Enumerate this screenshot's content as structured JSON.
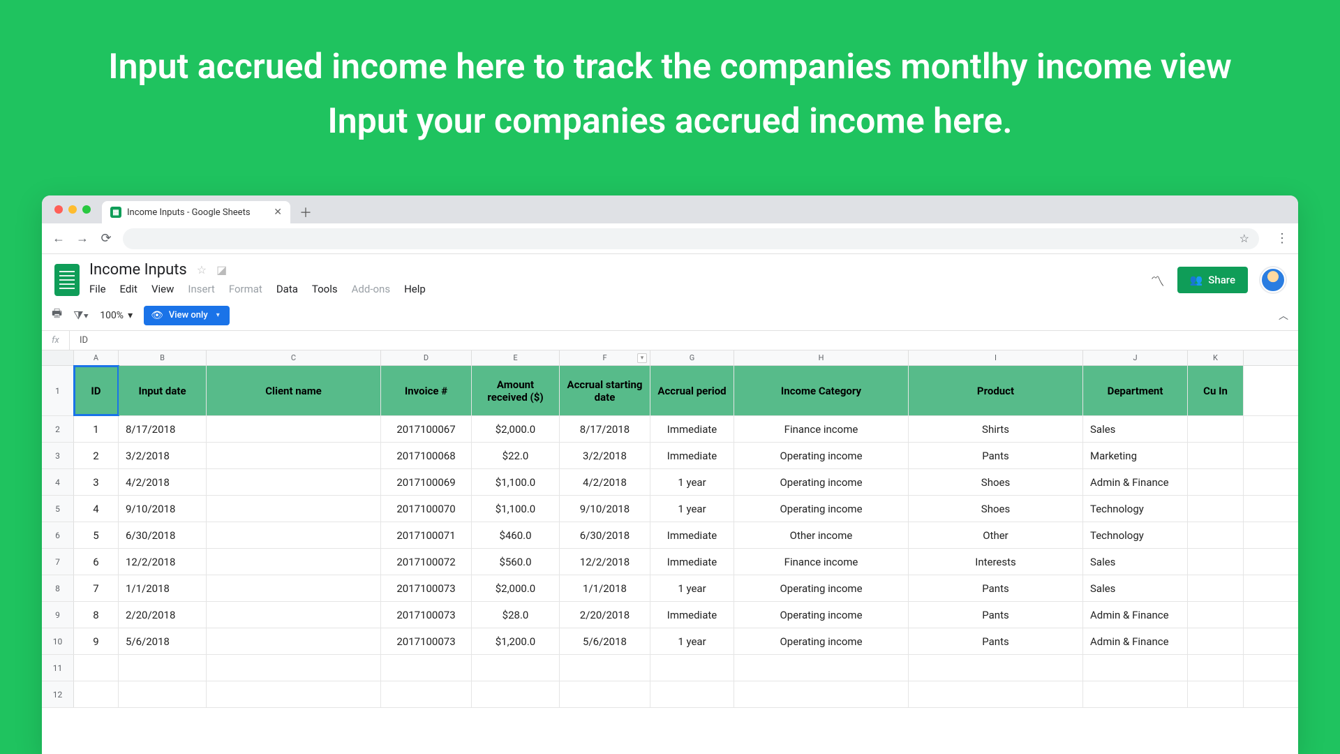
{
  "hero": "Input accrued income here to track the companies montlhy income view Input your companies accrued income here.",
  "browser": {
    "tab_title": "Income Inputs - Google Sheets",
    "favicon_glyph": "▦"
  },
  "doc": {
    "title": "Income Inputs",
    "menus": [
      "File",
      "Edit",
      "View",
      "Insert",
      "Format",
      "Data",
      "Tools",
      "Add-ons",
      "Help"
    ],
    "menus_dim": [
      "Insert",
      "Format",
      "Add-ons"
    ],
    "share_label": "Share"
  },
  "toolbar": {
    "zoom": "100%",
    "view_only": "View only"
  },
  "formula_bar": {
    "fx": "fx",
    "value": "ID"
  },
  "columns": [
    {
      "letter": "A",
      "w": "c-A"
    },
    {
      "letter": "B",
      "w": "c-B"
    },
    {
      "letter": "C",
      "w": "c-C"
    },
    {
      "letter": "D",
      "w": "c-D"
    },
    {
      "letter": "E",
      "w": "c-E"
    },
    {
      "letter": "F",
      "w": "c-F",
      "dd": true
    },
    {
      "letter": "G",
      "w": "c-G"
    },
    {
      "letter": "H",
      "w": "c-H"
    },
    {
      "letter": "I",
      "w": "c-I"
    },
    {
      "letter": "J",
      "w": "c-J"
    },
    {
      "letter": "K",
      "w": "c-K"
    }
  ],
  "headers": [
    "ID",
    "Input date",
    "Client name",
    "Invoice #",
    "Amount received ($)",
    "Accrual starting date",
    "Accrual period",
    "Income Category",
    "Product",
    "Department",
    "Cu In"
  ],
  "rows": [
    {
      "n": 2,
      "cells": [
        "1",
        "8/17/2018",
        "",
        "2017100067",
        "$2,000.0",
        "8/17/2018",
        "Immediate",
        "Finance income",
        "Shirts",
        "Sales",
        ""
      ]
    },
    {
      "n": 3,
      "cells": [
        "2",
        "3/2/2018",
        "",
        "2017100068",
        "$22.0",
        "3/2/2018",
        "Immediate",
        "Operating income",
        "Pants",
        "Marketing",
        ""
      ]
    },
    {
      "n": 4,
      "cells": [
        "3",
        "4/2/2018",
        "",
        "2017100069",
        "$1,100.0",
        "4/2/2018",
        "1 year",
        "Operating income",
        "Shoes",
        "Admin & Finance",
        ""
      ]
    },
    {
      "n": 5,
      "cells": [
        "4",
        "9/10/2018",
        "",
        "2017100070",
        "$1,100.0",
        "9/10/2018",
        "1 year",
        "Operating income",
        "Shoes",
        "Technology",
        ""
      ]
    },
    {
      "n": 6,
      "cells": [
        "5",
        "6/30/2018",
        "",
        "2017100071",
        "$460.0",
        "6/30/2018",
        "Immediate",
        "Other income",
        "Other",
        "Technology",
        ""
      ]
    },
    {
      "n": 7,
      "cells": [
        "6",
        "12/2/2018",
        "",
        "2017100072",
        "$560.0",
        "12/2/2018",
        "Immediate",
        "Finance income",
        "Interests",
        "Sales",
        ""
      ]
    },
    {
      "n": 8,
      "cells": [
        "7",
        "1/1/2018",
        "",
        "2017100073",
        "$2,000.0",
        "1/1/2018",
        "1 year",
        "Operating income",
        "Pants",
        "Sales",
        ""
      ]
    },
    {
      "n": 9,
      "cells": [
        "8",
        "2/20/2018",
        "",
        "2017100073",
        "$28.0",
        "2/20/2018",
        "Immediate",
        "Operating income",
        "Pants",
        "Admin & Finance",
        ""
      ]
    },
    {
      "n": 10,
      "cells": [
        "9",
        "5/6/2018",
        "",
        "2017100073",
        "$1,200.0",
        "5/6/2018",
        "1 year",
        "Operating income",
        "Pants",
        "Admin & Finance",
        ""
      ]
    },
    {
      "n": 11,
      "cells": [
        "",
        "",
        "",
        "",
        "",
        "",
        "",
        "",
        "",
        "",
        ""
      ]
    },
    {
      "n": 12,
      "cells": [
        "",
        "",
        "",
        "",
        "",
        "",
        "",
        "",
        "",
        "",
        ""
      ]
    }
  ],
  "chart_data": {
    "type": "table",
    "title": "Income Inputs",
    "columns": [
      "ID",
      "Input date",
      "Client name",
      "Invoice #",
      "Amount received ($)",
      "Accrual starting date",
      "Accrual period",
      "Income Category",
      "Product",
      "Department"
    ],
    "records": [
      {
        "ID": 1,
        "Input date": "8/17/2018",
        "Client name": "",
        "Invoice #": "2017100067",
        "Amount received ($)": 2000.0,
        "Accrual starting date": "8/17/2018",
        "Accrual period": "Immediate",
        "Income Category": "Finance income",
        "Product": "Shirts",
        "Department": "Sales"
      },
      {
        "ID": 2,
        "Input date": "3/2/2018",
        "Client name": "",
        "Invoice #": "2017100068",
        "Amount received ($)": 22.0,
        "Accrual starting date": "3/2/2018",
        "Accrual period": "Immediate",
        "Income Category": "Operating income",
        "Product": "Pants",
        "Department": "Marketing"
      },
      {
        "ID": 3,
        "Input date": "4/2/2018",
        "Client name": "",
        "Invoice #": "2017100069",
        "Amount received ($)": 1100.0,
        "Accrual starting date": "4/2/2018",
        "Accrual period": "1 year",
        "Income Category": "Operating income",
        "Product": "Shoes",
        "Department": "Admin & Finance"
      },
      {
        "ID": 4,
        "Input date": "9/10/2018",
        "Client name": "",
        "Invoice #": "2017100070",
        "Amount received ($)": 1100.0,
        "Accrual starting date": "9/10/2018",
        "Accrual period": "1 year",
        "Income Category": "Operating income",
        "Product": "Shoes",
        "Department": "Technology"
      },
      {
        "ID": 5,
        "Input date": "6/30/2018",
        "Client name": "",
        "Invoice #": "2017100071",
        "Amount received ($)": 460.0,
        "Accrual starting date": "6/30/2018",
        "Accrual period": "Immediate",
        "Income Category": "Other income",
        "Product": "Other",
        "Department": "Technology"
      },
      {
        "ID": 6,
        "Input date": "12/2/2018",
        "Client name": "",
        "Invoice #": "2017100072",
        "Amount received ($)": 560.0,
        "Accrual starting date": "12/2/2018",
        "Accrual period": "Immediate",
        "Income Category": "Finance income",
        "Product": "Interests",
        "Department": "Sales"
      },
      {
        "ID": 7,
        "Input date": "1/1/2018",
        "Client name": "",
        "Invoice #": "2017100073",
        "Amount received ($)": 2000.0,
        "Accrual starting date": "1/1/2018",
        "Accrual period": "1 year",
        "Income Category": "Operating income",
        "Product": "Pants",
        "Department": "Sales"
      },
      {
        "ID": 8,
        "Input date": "2/20/2018",
        "Client name": "",
        "Invoice #": "2017100073",
        "Amount received ($)": 28.0,
        "Accrual starting date": "2/20/2018",
        "Accrual period": "Immediate",
        "Income Category": "Operating income",
        "Product": "Pants",
        "Department": "Admin & Finance"
      },
      {
        "ID": 9,
        "Input date": "5/6/2018",
        "Client name": "",
        "Invoice #": "2017100073",
        "Amount received ($)": 1200.0,
        "Accrual starting date": "5/6/2018",
        "Accrual period": "1 year",
        "Income Category": "Operating income",
        "Product": "Pants",
        "Department": "Admin & Finance"
      }
    ]
  }
}
